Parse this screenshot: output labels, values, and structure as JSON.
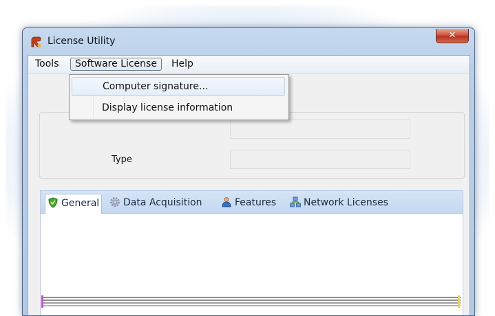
{
  "window": {
    "title": "License Utility",
    "close_glyph": "✕"
  },
  "menubar": {
    "items": [
      {
        "label": "Tools"
      },
      {
        "label": "Software License"
      },
      {
        "label": "Help"
      }
    ]
  },
  "software_license_menu": {
    "items": [
      {
        "label": "Computer signature..."
      },
      {
        "label": "Display license information"
      }
    ]
  },
  "license_info": {
    "type_label": "Type",
    "type_value": "",
    "top_value": ""
  },
  "tabs": [
    {
      "label": "General",
      "icon": "shield-icon",
      "selected": true
    },
    {
      "label": "Data Acquisition",
      "icon": "gear-icon",
      "selected": false
    },
    {
      "label": "Features",
      "icon": "user-icon",
      "selected": false
    },
    {
      "label": "Network Licenses",
      "icon": "network-icon",
      "selected": false
    }
  ],
  "colors": {
    "title_bar": "#c6d9ef",
    "tab_strip": "#d5e4f7",
    "close_button": "#d2533c"
  }
}
